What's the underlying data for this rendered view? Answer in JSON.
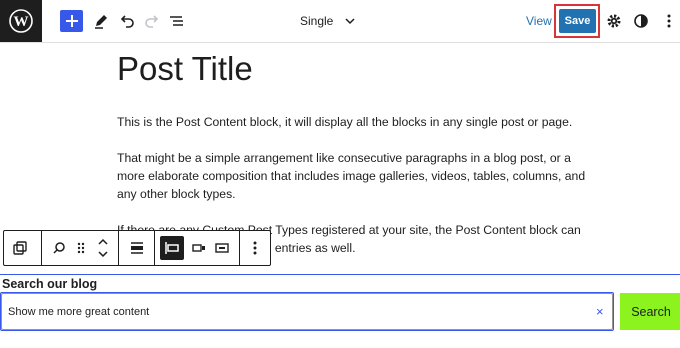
{
  "header": {
    "document_title": "Single",
    "view_label": "View",
    "save_label": "Save"
  },
  "post": {
    "title": "Post Title",
    "paragraphs": [
      "This is the Post Content block, it will display all the blocks in any single post or page.",
      "That might be a simple arrangement like consecutive paragraphs in a blog post, or a more elaborate composition that includes image galleries, videos, tables, columns, and any other block types.",
      "If there are any Custom Post Types registered at your site, the Post Content block can display the contents of those entries as well."
    ]
  },
  "search_block": {
    "label": "Search our blog",
    "input_value": "Show me more great content",
    "clear_glyph": "×",
    "button_label": "Search"
  },
  "colors": {
    "accent": "#3858e9",
    "save_button": "#2271b1",
    "highlight": "#d63638",
    "search_button": "#8cf31f"
  },
  "icons": {
    "toolbar": [
      "wordpress-logo-icon",
      "plus-icon",
      "pencil-icon",
      "undo-icon",
      "redo-icon",
      "list-view-icon",
      "chevron-down-icon",
      "gear-icon",
      "contrast-icon",
      "more-vertical-icon"
    ],
    "block_toolbar": [
      "transform-icon",
      "search-icon",
      "drag-handle-icon",
      "move-up-icon",
      "move-down-icon",
      "justify-icon",
      "align-left-icon",
      "button-outside-icon",
      "button-inside-icon",
      "more-vertical-icon"
    ]
  }
}
